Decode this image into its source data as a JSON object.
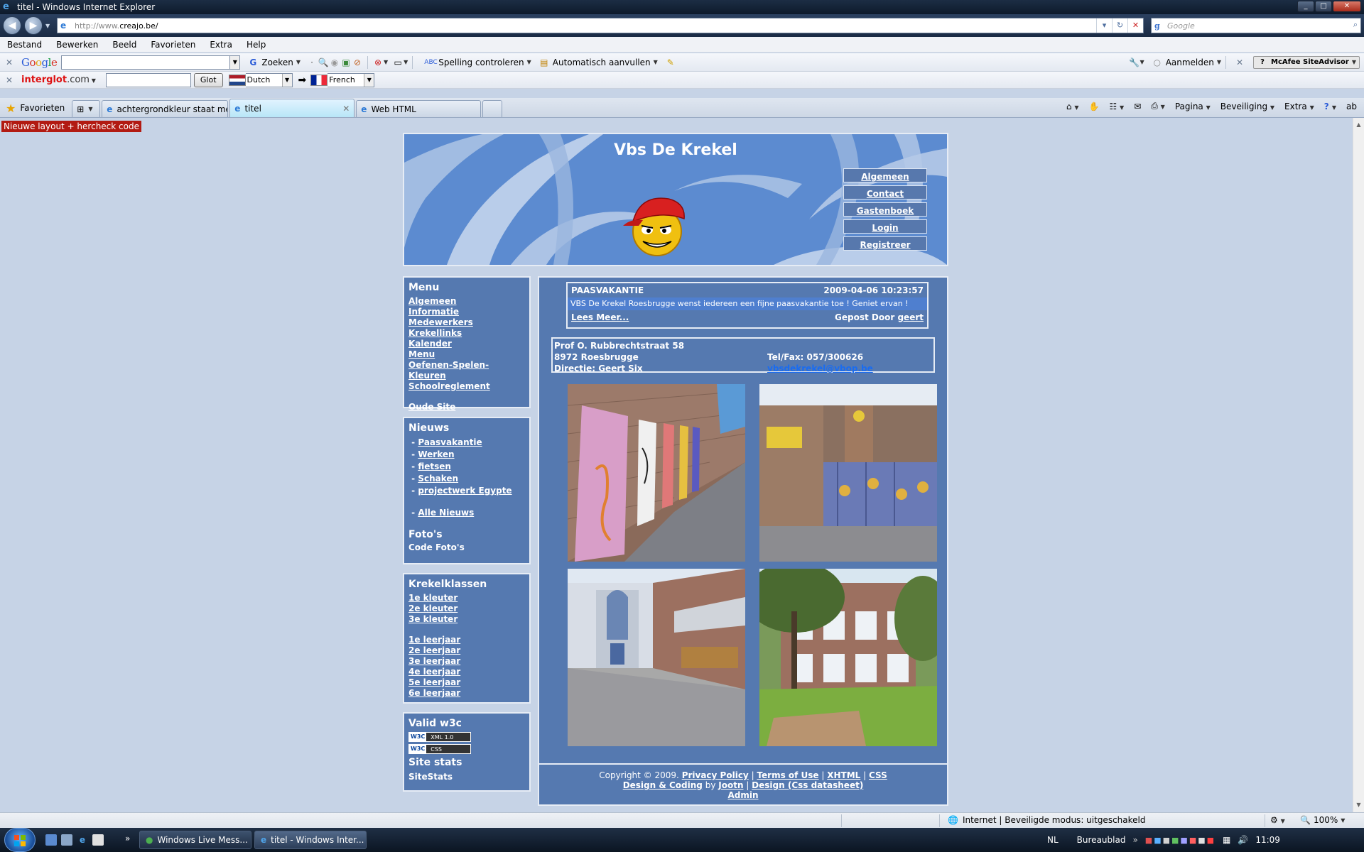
{
  "window": {
    "title": "titel - Windows Internet Explorer",
    "url_prefix": "http://www.",
    "url_host": "creajo.be/",
    "search_placeholder": "Google"
  },
  "menubar": [
    "Bestand",
    "Bewerken",
    "Beeld",
    "Favorieten",
    "Extra",
    "Help"
  ],
  "google_toolbar": {
    "logo": "Google",
    "search_label": "Zoeken",
    "spell_label": "Spelling controleren",
    "autofill_label": "Automatisch aanvullen",
    "signin_label": "Aanmelden",
    "mcafee_label": "McAfee SiteAdvisor"
  },
  "interglot_toolbar": {
    "logo": "interglot",
    "logo_suffix": ".com",
    "glot_label": "Glot",
    "from_language": "Dutch",
    "to_language": "French"
  },
  "tabs": {
    "favorites_label": "Favorieten",
    "items": [
      {
        "label": "achtergrondkleur staat me..."
      },
      {
        "label": "titel"
      },
      {
        "label": "Web HTML"
      }
    ],
    "tools": [
      "Pagina",
      "Beveiliging",
      "Extra"
    ]
  },
  "page": {
    "notice": "Nieuwe layout + hercheck code",
    "site_title": "Vbs De Krekel",
    "header_nav": [
      "Algemeen",
      "Contact",
      "Gastenboek",
      "Login",
      "Registreer"
    ],
    "menu_box": {
      "title": "Menu",
      "links": [
        "Algemeen",
        "Informatie",
        "Medewerkers",
        "Krekellinks",
        "Kalender",
        "Menu",
        "Oefenen-Spelen-Kleuren",
        "Schoolreglement"
      ],
      "extra_link": "Oude Site"
    },
    "news_box": {
      "title": "Nieuws",
      "items": [
        "Paasvakantie",
        "Werken",
        "fietsen",
        "Schaken",
        "projectwerk Egypte"
      ],
      "all_news": "Alle Nieuws",
      "photos_title": "Foto's",
      "code_photos": "Code Foto's"
    },
    "classes_box": {
      "title": "Krekelklassen",
      "kleuter": [
        "1e kleuter",
        "2e kleuter",
        "3e kleuter"
      ],
      "leerjaar": [
        "1e leerjaar",
        "2e leerjaar",
        "3e leerjaar",
        "4e leerjaar",
        "5e leerjaar",
        "6e leerjaar"
      ]
    },
    "valid_box": {
      "title": "Valid w3c",
      "badges": [
        {
          "w3c": "W3C",
          "text": "XML 1.0"
        },
        {
          "w3c": "W3C",
          "text": "CSS"
        }
      ],
      "site_stats_title": "Site stats",
      "sitestats": "SiteStats"
    },
    "news_item": {
      "title": "PAASVAKANTIE",
      "date": "2009-04-06 10:23:57",
      "body": "VBS De Krekel Roesbrugge wenst iedereen een fijne paasvakantie toe ! Geniet ervan !",
      "read_more": "Lees Meer...",
      "posted_by": "Gepost Door",
      "author": "geert"
    },
    "address": {
      "street": "Prof O. Rubbrechtstraat 58",
      "city": "8972 Roesbrugge",
      "director": "Directie: Geert Six",
      "phone": "Tel/Fax: 057/300626",
      "email": "vbsdekrekel@vbop.be"
    },
    "footer": {
      "copyright": "Copyright © 2009.",
      "privacy": "Privacy Policy",
      "terms": "Terms of Use",
      "xhtml": "XHTML",
      "css": "CSS",
      "design_coding": "Design & Coding",
      "by": "by",
      "jootn": "Jootn",
      "design_css": "Design (Css datasheet)",
      "admin": "Admin"
    }
  },
  "statusbar": {
    "zone": "Internet | Beveiligde modus: uitgeschakeld",
    "zoom": "100%"
  },
  "taskbar": {
    "tasks": [
      "Windows Live Mess...",
      "titel - Windows Inter..."
    ],
    "language": "NL",
    "desktop": "Bureaublad",
    "clock": "11:09"
  },
  "colors": {
    "page_bg": "#c6d3e6",
    "box_bg": "#5579b0",
    "header_bg": "#5c8bd0",
    "notice_bg": "#b21a12",
    "email_link": "#1a6cf0"
  }
}
